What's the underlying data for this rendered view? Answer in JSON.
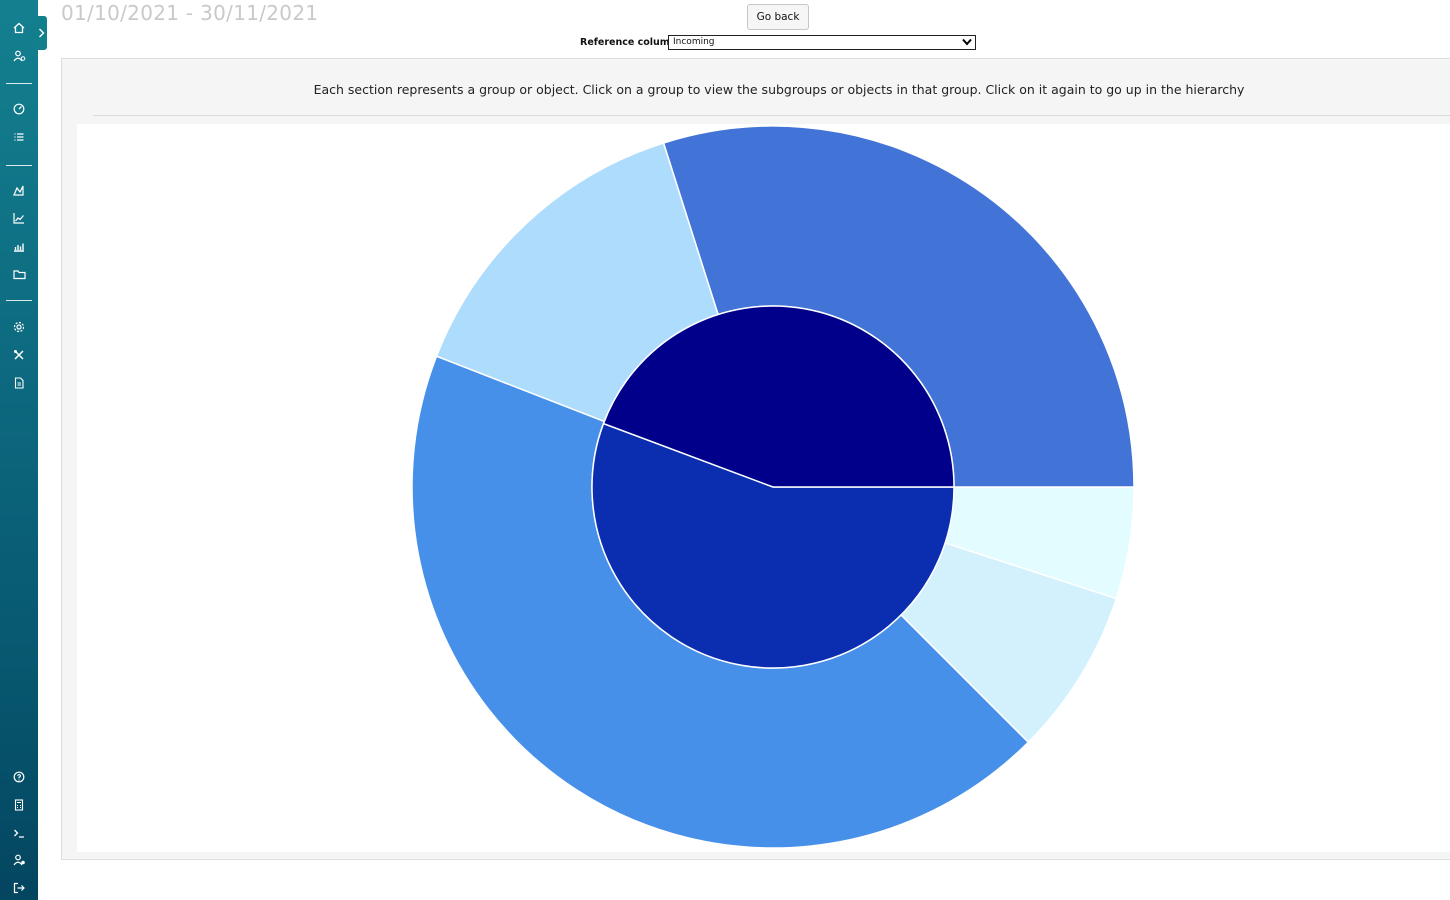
{
  "header": {
    "date_range": "01/10/2021 - 30/11/2021",
    "go_back_label": "Go back",
    "reference_column_label": "Reference column",
    "reference_column_value": "Incoming"
  },
  "instructions": "Each section represents a group or object. Click on a group to view the subgroups or objects in that group. Click on it again to go up in the hierarchy",
  "sidebar": {
    "icons": [
      "home-icon",
      "user-icon",
      "dashboard-icon",
      "list-icon",
      "area-chart-icon",
      "line-chart-icon",
      "bar-chart-icon",
      "folder-icon",
      "settings-icon",
      "tools-icon",
      "document-icon",
      "help-icon",
      "calculator-icon",
      "terminal-icon",
      "user-settings-icon",
      "logout-icon"
    ]
  },
  "chart_data": {
    "type": "sunburst",
    "title": "",
    "rings": [
      {
        "level": 1,
        "segments": [
          {
            "value": 44.3,
            "color": "#00008b"
          },
          {
            "value": 55.7,
            "color": "#0b2eb0"
          }
        ]
      },
      {
        "level": 2,
        "segments": [
          {
            "value": 5.0,
            "color": "#e3fcff"
          },
          {
            "value": 7.5,
            "color": "#d3f1fc"
          },
          {
            "value": 43.4,
            "color": "#4790ea"
          },
          {
            "value": 14.2,
            "color": "#addcfc"
          },
          {
            "value": 29.9,
            "color": "#4273d7"
          }
        ]
      }
    ]
  }
}
